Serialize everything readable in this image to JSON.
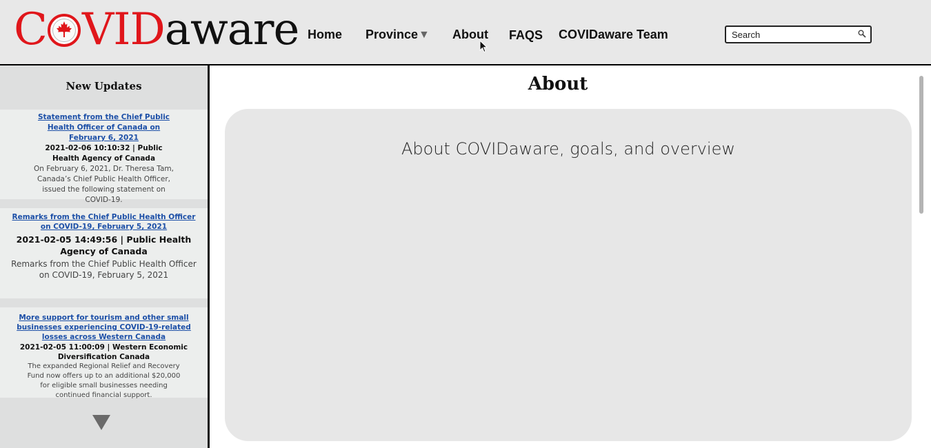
{
  "logo": {
    "part_c": "C",
    "part_vid": "VID",
    "part_aware": "aware"
  },
  "nav": {
    "home": "Home",
    "province": "Province",
    "province_caret": "▼",
    "about": "About",
    "faqs": "FAQS",
    "team": "COVIDaware Team"
  },
  "search": {
    "placeholder": "Search"
  },
  "sidebar": {
    "title": "New Updates",
    "updates": [
      {
        "title": "Statement from the Chief Public Health Officer of Canada on February 6, 2021",
        "meta": "2021-02-06 10:10:32 | Public Health Agency of Canada",
        "summary": "On February 6, 2021, Dr. Theresa Tam, Canada’s Chief Public Health Officer, issued the following statement on COVID-19."
      },
      {
        "title": "Remarks from the Chief Public Health Officer on COVID-19, February 5, 2021",
        "meta": "2021-02-05 14:49:56 | Public Health Agency of Canada",
        "summary": "Remarks from the Chief Public Health Officer on COVID-19, February 5, 2021"
      },
      {
        "title": "More support for tourism and other small businesses experiencing COVID-19-related losses across Western Canada",
        "meta": "2021-02-05 11:00:09 | Western Economic Diversification Canada",
        "summary": "The expanded Regional Relief and Recovery Fund now offers up to an additional $20,000 for eligible small businesses needing continued financial support."
      }
    ]
  },
  "main": {
    "title": "About",
    "heading": "About COVIDaware, goals, and overview"
  },
  "colors": {
    "brand_red": "#e0161b",
    "link_blue": "#1c4fa7",
    "header_bg": "#e8e8e8",
    "panel_bg": "#e7e7e7"
  },
  "icons": {
    "logo_o": "maple-leaf-icon",
    "search": "magnifier-icon",
    "sidebar_more": "triangle-down-icon",
    "cursor": "mouse-pointer-icon"
  }
}
